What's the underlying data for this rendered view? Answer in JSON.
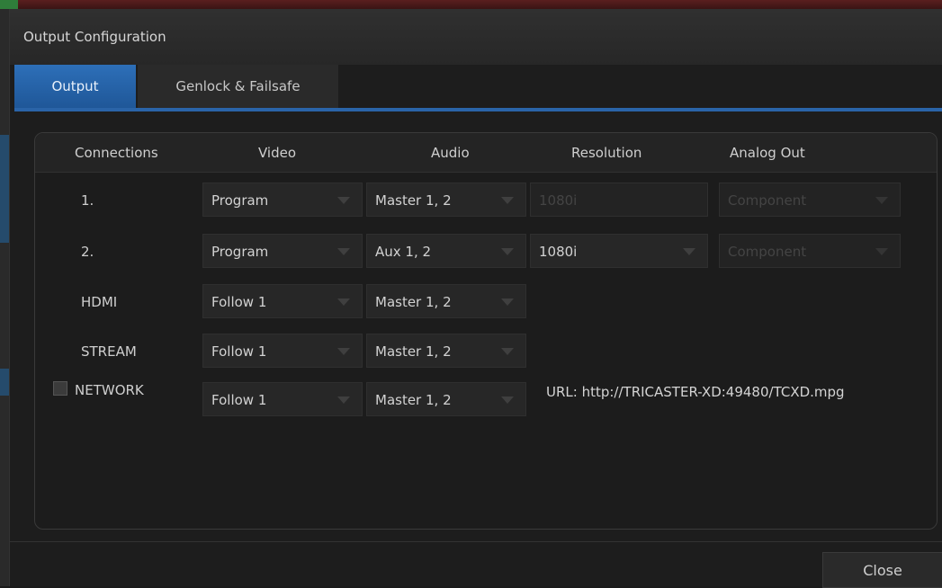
{
  "window": {
    "title": "Output Configuration"
  },
  "tabs": [
    {
      "label": "Output",
      "active": true
    },
    {
      "label": "Genlock & Failsafe",
      "active": false
    }
  ],
  "columns": [
    "Connections",
    "Video",
    "Audio",
    "Resolution",
    "Analog Out"
  ],
  "rows": [
    {
      "connection": "1.",
      "video": "Program",
      "audio": "Master 1, 2",
      "resolution": "1080i",
      "resolution_enabled": false,
      "analog_out": "Component",
      "analog_out_enabled": false
    },
    {
      "connection": "2.",
      "video": "Program",
      "audio": "Aux 1, 2",
      "resolution": "1080i",
      "resolution_enabled": true,
      "analog_out": "Component",
      "analog_out_enabled": false
    },
    {
      "connection": "HDMI",
      "video": "Follow 1",
      "audio": "Master 1, 2"
    },
    {
      "connection": "STREAM",
      "video": "Follow 1",
      "audio": "Master 1, 2"
    },
    {
      "connection": "NETWORK",
      "video": "Follow 1",
      "audio": "Master 1, 2",
      "enabled_checkbox": false,
      "url": "URL:  http://TRICASTER-XD:49480/TCXD.mpg"
    }
  ],
  "footer": {
    "close_label": "Close"
  },
  "colors": {
    "accent": "#2a64a8",
    "background": "#1d1d1d"
  }
}
